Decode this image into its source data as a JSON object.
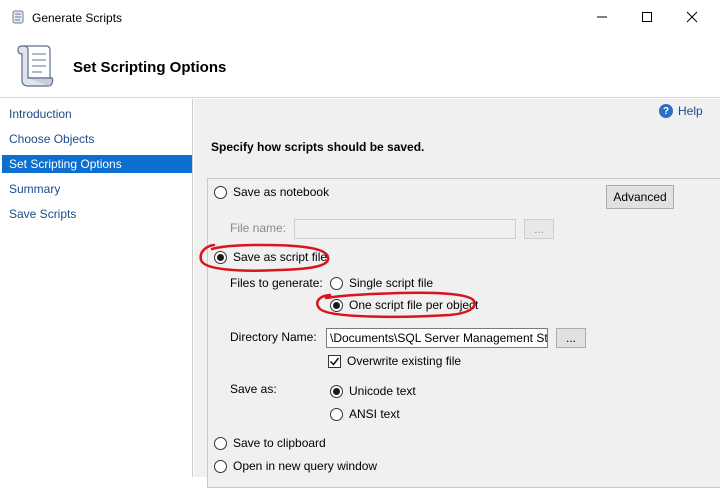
{
  "window": {
    "title": "Generate Scripts",
    "controls": {
      "minimize": "minimize-icon",
      "maximize": "maximize-icon",
      "close": "close-icon"
    }
  },
  "header": {
    "page_title": "Set Scripting Options"
  },
  "nav": {
    "items": [
      {
        "label": "Introduction",
        "selected": false
      },
      {
        "label": "Choose Objects",
        "selected": false
      },
      {
        "label": "Set Scripting Options",
        "selected": true
      },
      {
        "label": "Summary",
        "selected": false
      },
      {
        "label": "Save Scripts",
        "selected": false
      }
    ]
  },
  "content": {
    "help_label": "Help",
    "heading": "Specify how scripts should be saved.",
    "options": {
      "save_as_notebook": {
        "label": "Save as notebook",
        "selected": false
      },
      "advanced_label": "Advanced",
      "file_name_label": "File name:",
      "file_name_value": "",
      "browse_label": "...",
      "save_as_script_file": {
        "label": "Save as script file",
        "selected": true
      },
      "files_to_generate_label": "Files to generate:",
      "single_script_file": {
        "label": "Single script file",
        "selected": false
      },
      "one_script_per_object": {
        "label": "One script file per object",
        "selected": true
      },
      "directory_name_label": "Directory Name:",
      "directory_name_value": "\\Documents\\SQL Server Management Studio",
      "directory_browse_label": "...",
      "overwrite_existing": {
        "label": "Overwrite existing file",
        "checked": true
      },
      "save_as_label": "Save as:",
      "unicode_text": {
        "label": "Unicode text",
        "selected": true
      },
      "ansi_text": {
        "label": "ANSI text",
        "selected": false
      },
      "save_to_clipboard": {
        "label": "Save to clipboard",
        "selected": false
      },
      "open_in_new_query_window": {
        "label": "Open in new query window",
        "selected": false
      }
    }
  },
  "colors": {
    "selection": "#0b6fcf",
    "link": "#1a4b8c",
    "annotation": "#d8141c",
    "panel": "#f0f0f0"
  }
}
